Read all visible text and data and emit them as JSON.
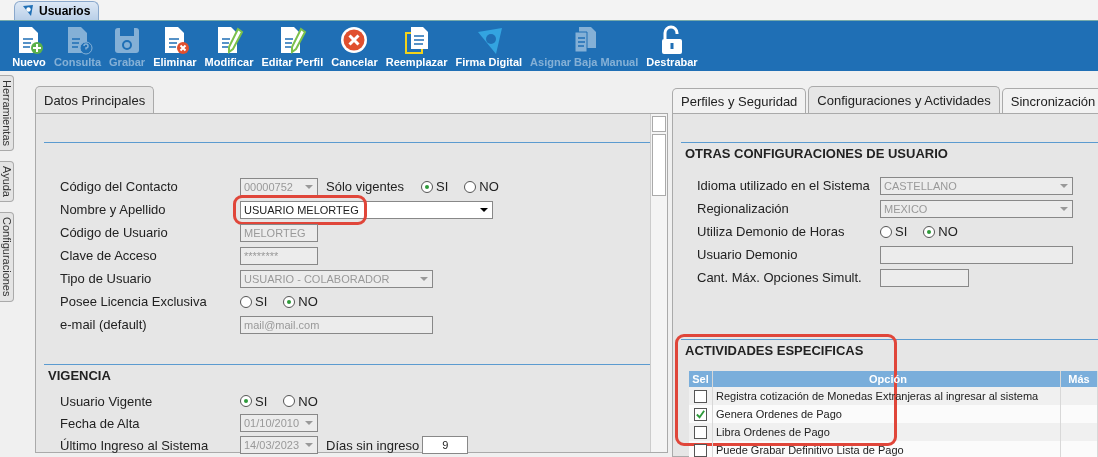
{
  "window_tab": {
    "title": "Usuarios"
  },
  "toolbar": [
    {
      "label": "Nuevo",
      "kind": "doc-plus",
      "disabled": false
    },
    {
      "label": "Consulta",
      "kind": "doc-question",
      "disabled": true
    },
    {
      "label": "Grabar",
      "kind": "floppy",
      "disabled": true
    },
    {
      "label": "Eliminar",
      "kind": "doc-x",
      "disabled": false
    },
    {
      "label": "Modificar",
      "kind": "doc-pen",
      "disabled": false
    },
    {
      "label": "Editar Perfil",
      "kind": "doc-pen",
      "disabled": false
    },
    {
      "label": "Cancelar",
      "kind": "circle-x",
      "disabled": false
    },
    {
      "label": "Reemplazar",
      "kind": "docs",
      "disabled": false
    },
    {
      "label": "Firma Digital",
      "kind": "swirl",
      "disabled": false
    },
    {
      "label": "Asignar Baja Manual",
      "kind": "doc-stack",
      "disabled": true
    },
    {
      "label": "Destrabar",
      "kind": "lock",
      "disabled": false
    }
  ],
  "side_tabs": [
    "Herramientas",
    "Ayuda",
    "Configuraciones"
  ],
  "left_panel": {
    "tabs": [
      {
        "label": "Datos Principales",
        "selected": true
      }
    ],
    "fields": [
      {
        "kind": "combo",
        "label": "Código del Contacto",
        "value": "00000752",
        "disabled": true,
        "extra": {
          "kind": "radio",
          "label": "Sólo vigentes",
          "options": [
            {
              "label": "SI",
              "selected": true
            },
            {
              "label": "NO",
              "selected": false
            }
          ]
        }
      },
      {
        "kind": "combo",
        "label": "Nombre y Apellido",
        "value": "USUARIO MELORTEG",
        "disabled": false,
        "highlighted": true
      },
      {
        "kind": "text",
        "label": "Código de Usuario",
        "value": "MELORTEG",
        "disabled": true
      },
      {
        "kind": "text",
        "label": "Clave de Acceso",
        "value": "********",
        "disabled": true
      },
      {
        "kind": "combo",
        "label": "Tipo de Usuario",
        "value": "USUARIO - COLABORADOR",
        "disabled": true
      },
      {
        "kind": "radio",
        "label": "Posee Licencia Exclusiva",
        "options": [
          {
            "label": "SI",
            "selected": false
          },
          {
            "label": "NO",
            "selected": true
          }
        ]
      },
      {
        "kind": "text",
        "label": "e-mail (default)",
        "value": "mail@mail.com",
        "disabled": true
      }
    ],
    "vigencia": {
      "title": "VIGENCIA",
      "fields": [
        {
          "kind": "radio",
          "label": "Usuario Vigente",
          "options": [
            {
              "label": "SI",
              "selected": true
            },
            {
              "label": "NO",
              "selected": false
            }
          ]
        },
        {
          "kind": "combo",
          "label": "Fecha de Alta",
          "value": "01/10/2010",
          "disabled": true
        },
        {
          "kind": "combo",
          "label": "Último Ingreso al Sistema",
          "value": "14/03/2023",
          "disabled": true,
          "extra": {
            "kind": "text",
            "label": "Días sin ingreso",
            "value": "9",
            "disabled": false
          }
        }
      ]
    }
  },
  "right_panel": {
    "tabs": [
      {
        "label": "Perfiles y Seguridad",
        "selected": false
      },
      {
        "label": "Configuraciones y Actividades",
        "selected": true
      },
      {
        "label": "Sincronización",
        "selected": false
      }
    ],
    "otras": {
      "title": "OTRAS CONFIGURACIONES DE USUARIO",
      "fields": [
        {
          "kind": "combo",
          "label": "Idioma utilizado en el Sistema",
          "value": "CASTELLANO",
          "disabled": true
        },
        {
          "kind": "combo",
          "label": "Regionalización",
          "value": "MEXICO",
          "disabled": true
        },
        {
          "kind": "radio",
          "label": "Utiliza Demonio de Horas",
          "options": [
            {
              "label": "SI",
              "selected": false
            },
            {
              "label": "NO",
              "selected": true
            }
          ]
        },
        {
          "kind": "text",
          "label": "Usuario Demonio",
          "disabled": true
        },
        {
          "kind": "text",
          "label": "Cant. Máx. Opciones Simult.",
          "disabled": true
        }
      ]
    },
    "actividades": {
      "title": "ACTIVIDADES ESPECIFICAS",
      "highlighted": true,
      "columns": [
        "Sel",
        "Opción",
        "Más"
      ],
      "rows": [
        {
          "checked": false,
          "option": "Registra cotización de Monedas Extranjeras al ingresar al sistema"
        },
        {
          "checked": true,
          "option": "Genera Ordenes de Pago"
        },
        {
          "checked": false,
          "option": "Libra Ordenes de Pago"
        },
        {
          "checked": false,
          "option": "Puede Grabar Definitivo Lista de Pago"
        }
      ]
    }
  }
}
